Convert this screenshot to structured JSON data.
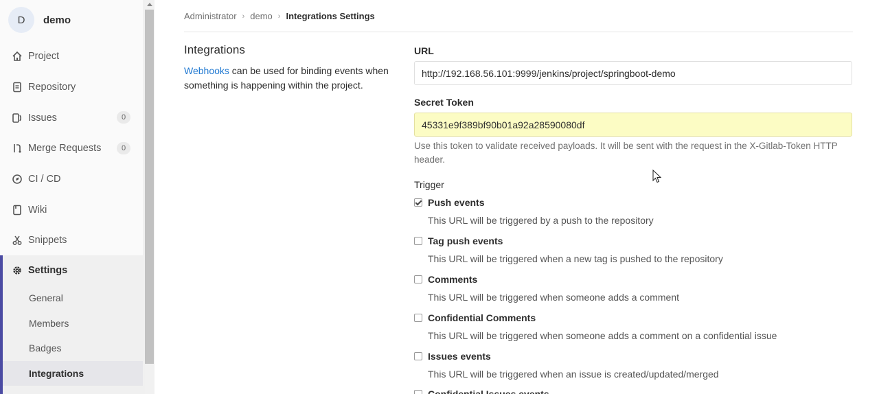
{
  "project": {
    "avatar_letter": "D",
    "name": "demo"
  },
  "sidebar": {
    "items": [
      {
        "label": "Project",
        "icon": "home-icon"
      },
      {
        "label": "Repository",
        "icon": "document-icon"
      },
      {
        "label": "Issues",
        "icon": "issues-icon",
        "badge": "0"
      },
      {
        "label": "Merge Requests",
        "icon": "merge-request-icon",
        "badge": "0"
      },
      {
        "label": "CI / CD",
        "icon": "rocket-icon"
      },
      {
        "label": "Wiki",
        "icon": "book-icon"
      },
      {
        "label": "Snippets",
        "icon": "scissors-icon"
      }
    ],
    "settings": {
      "label": "Settings",
      "sub": [
        "General",
        "Members",
        "Badges",
        "Integrations"
      ]
    }
  },
  "breadcrumb": {
    "items": [
      "Administrator",
      "demo"
    ],
    "current": "Integrations Settings"
  },
  "intro": {
    "title": "Integrations",
    "link": "Webhooks",
    "text": " can be used for binding events when something is happening within the project."
  },
  "form": {
    "url_label": "URL",
    "url_value": "http://192.168.56.101:9999/jenkins/project/springboot-demo",
    "token_label": "Secret Token",
    "token_value": "45331e9f389bf90b01a92a28590080df",
    "token_help": "Use this token to validate received payloads. It will be sent with the request in the X-Gitlab-Token HTTP header.",
    "trigger_label": "Trigger",
    "triggers": [
      {
        "label": "Push events",
        "desc": "This URL will be triggered by a push to the repository",
        "checked": true
      },
      {
        "label": "Tag push events",
        "desc": "This URL will be triggered when a new tag is pushed to the repository",
        "checked": false
      },
      {
        "label": "Comments",
        "desc": "This URL will be triggered when someone adds a comment",
        "checked": false
      },
      {
        "label": "Confidential Comments",
        "desc": "This URL will be triggered when someone adds a comment on a confidential issue",
        "checked": false
      },
      {
        "label": "Issues events",
        "desc": "This URL will be triggered when an issue is created/updated/merged",
        "checked": false
      },
      {
        "label": "Confidential Issues events",
        "desc": "",
        "checked": false
      }
    ]
  },
  "colors": {
    "accent": "#4b4ba3",
    "link": "#1f78d1",
    "token_bg": "#fcfcc4"
  }
}
